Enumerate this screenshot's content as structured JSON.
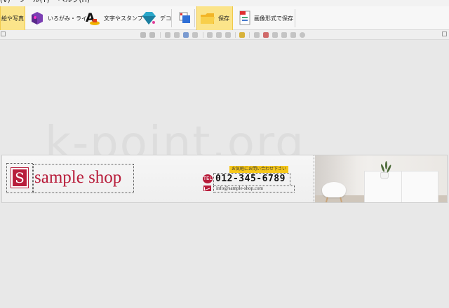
{
  "menubar": {
    "items": [
      "(V)",
      "ツール(T)",
      "ヘルプ(H)"
    ]
  },
  "ribbon": {
    "buttons": [
      {
        "label": "絵や写真",
        "icon": "picture-icon",
        "active": true
      },
      {
        "label": "いろがみ・ライン",
        "icon": "paper-color-icon",
        "active": false
      },
      {
        "label": "文字やスタンプ",
        "icon": "text-stamp-icon",
        "active": false
      },
      {
        "label": "デコ",
        "icon": "gem-deco-icon",
        "active": false
      },
      {
        "label": "",
        "icon": "layer-copy-icon",
        "active": false
      },
      {
        "label": "保存",
        "icon": "folder-save-icon",
        "active": true
      },
      {
        "label": "画像形式で保存",
        "icon": "image-format-save-icon",
        "active": false
      }
    ]
  },
  "canvas": {
    "watermark": "k-point.org",
    "logo_letter": "S",
    "shop_name": "sample shop",
    "badge": "お気軽にお問い合わせ下さい",
    "phone": "012-345-6789",
    "email": "info@sample-shop.com",
    "tel_icon_label": "TEL"
  },
  "colors": {
    "brand": "#b81d3b",
    "badge": "#f6c71a",
    "ribbon_active": "#fbe48a"
  }
}
